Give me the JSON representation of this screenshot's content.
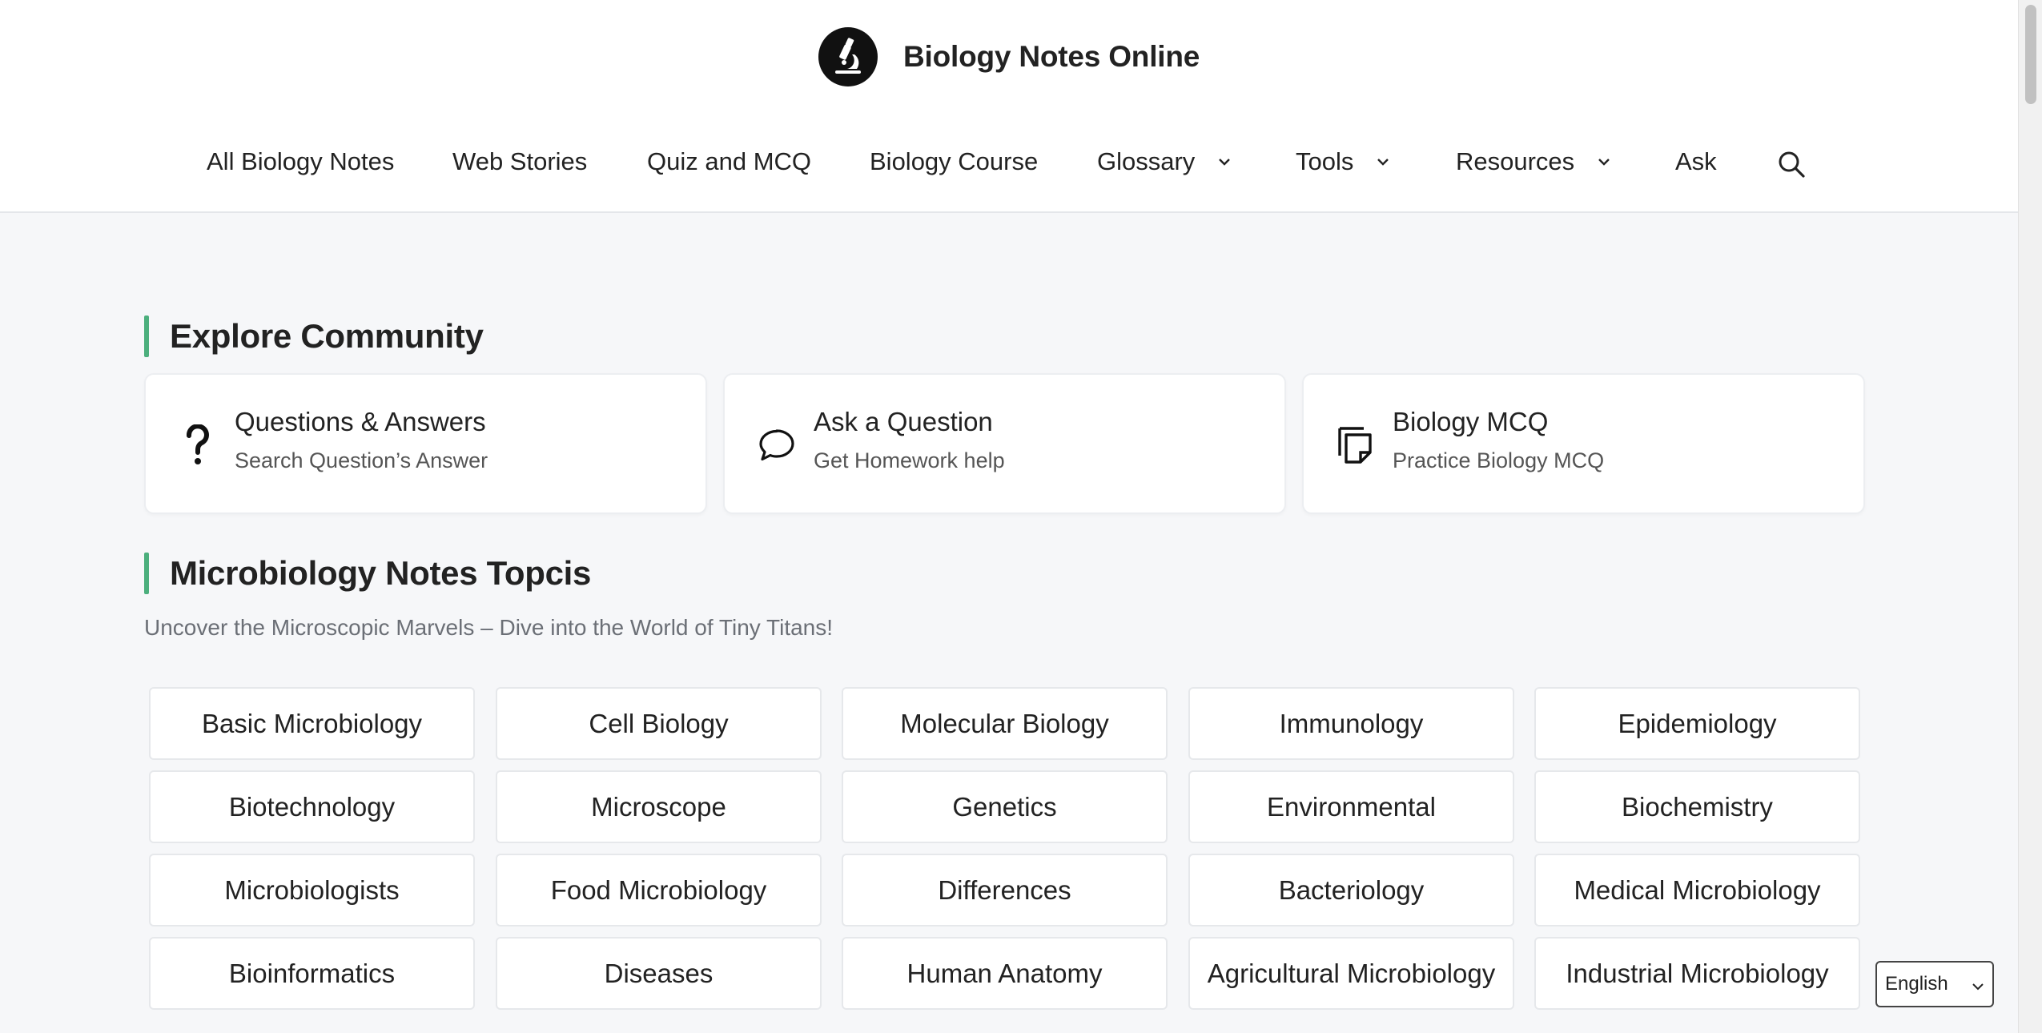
{
  "header": {
    "site_title": "Biology Notes Online",
    "logo_icon": "microscope-icon",
    "nav": [
      {
        "label": "All Biology Notes",
        "has_dropdown": false
      },
      {
        "label": "Web Stories",
        "has_dropdown": false
      },
      {
        "label": "Quiz and MCQ",
        "has_dropdown": false
      },
      {
        "label": "Biology Course",
        "has_dropdown": false
      },
      {
        "label": "Glossary",
        "has_dropdown": true
      },
      {
        "label": "Tools",
        "has_dropdown": true
      },
      {
        "label": "Resources",
        "has_dropdown": true
      },
      {
        "label": "Ask",
        "has_dropdown": false
      }
    ],
    "search_icon": "search-icon"
  },
  "community": {
    "title": "Explore Community",
    "cards": [
      {
        "icon": "question-mark-icon",
        "title": "Questions & Answers",
        "subtitle": "Search Question’s Answer"
      },
      {
        "icon": "speech-bubble-icon",
        "title": "Ask a Question",
        "subtitle": "Get Homework help"
      },
      {
        "icon": "copy-document-icon",
        "title": "Biology MCQ",
        "subtitle": "Practice Biology MCQ"
      }
    ]
  },
  "topics": {
    "title": "Microbiology Notes Topcis",
    "subtitle": "Uncover the Microscopic Marvels – Dive into the World of Tiny Titans!",
    "items": [
      "Basic Microbiology",
      "Cell Biology",
      "Molecular Biology",
      "Immunology",
      "Epidemiology",
      "Biotechnology",
      "Microscope",
      "Genetics",
      "Environmental",
      "Biochemistry",
      "Microbiologists",
      "Food Microbiology",
      "Differences",
      "Bacteriology",
      "Medical Microbiology",
      "Bioinformatics",
      "Diseases",
      "Human Anatomy",
      "Agricultural Microbiology",
      "Industrial Microbiology"
    ]
  },
  "language_select": {
    "value": "English"
  },
  "colors": {
    "accent": "#4caf7d",
    "background": "#f6f7f9",
    "card": "#ffffff"
  }
}
